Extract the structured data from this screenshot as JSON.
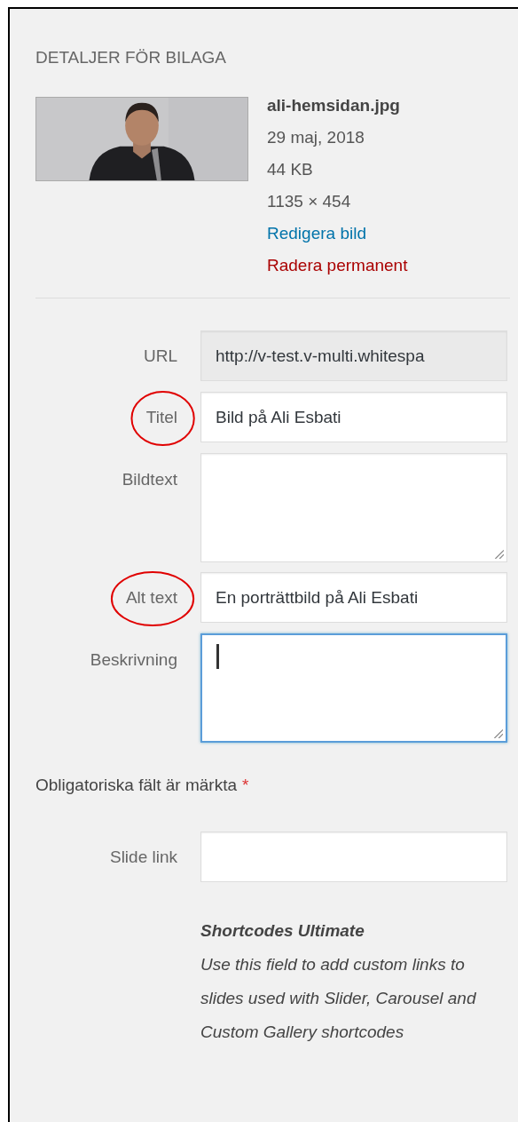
{
  "heading": "DETALJER FÖR BILAGA",
  "attachment": {
    "filename": "ali-hemsidan.jpg",
    "date": "29 maj, 2018",
    "size": "44 KB",
    "dimensions": "1135 × 454",
    "edit_link": "Redigera bild",
    "delete_link": "Radera permanent"
  },
  "fields": [
    {
      "label": "URL",
      "kind": "input",
      "value": "http://v-test.v-multi.whitespa",
      "readonly": true,
      "focused": false,
      "circled": false
    },
    {
      "label": "Titel",
      "kind": "input",
      "value": "Bild på Ali Esbati",
      "readonly": false,
      "focused": false,
      "circled": true
    },
    {
      "label": "Bildtext",
      "kind": "textarea",
      "readonly": false,
      "focused": false,
      "circled": false
    },
    {
      "label": "Alt text",
      "kind": "input",
      "value": "En porträttbild på Ali Esbati",
      "readonly": false,
      "focused": false,
      "circled": true
    },
    {
      "label": "Beskrivning",
      "kind": "textarea",
      "readonly": false,
      "focused": true,
      "circled": false
    }
  ],
  "required_note": {
    "text": "Obligatoriska fält är märkta",
    "marker": "*"
  },
  "extra_fields": [
    {
      "label": "Slide link",
      "kind": "input",
      "readonly": false,
      "focused": false,
      "circled": false
    }
  ],
  "help": {
    "title": "Shortcodes Ultimate",
    "text": "Use this field to add custom links to slides used with Slider, Carousel and Custom Gallery shortcodes"
  }
}
